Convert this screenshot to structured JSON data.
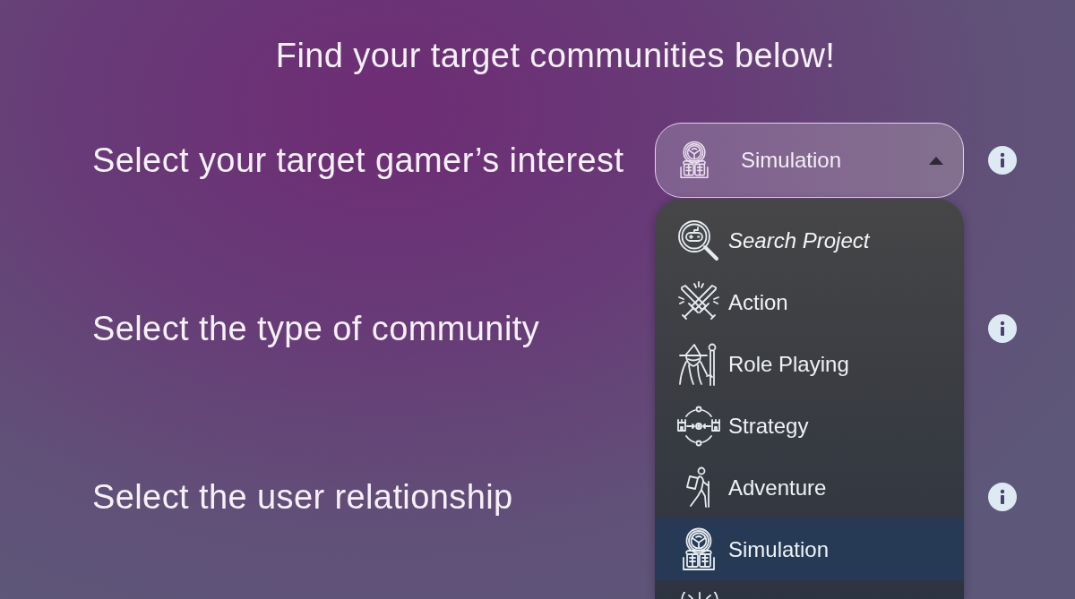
{
  "heading": "Find your target communities below!",
  "rows": [
    {
      "label": "Select your target gamer’s interest",
      "dropdown": {
        "value": "Simulation",
        "expanded": true
      }
    },
    {
      "label": "Select the type of community"
    },
    {
      "label": "Select the user relationship"
    }
  ],
  "menu": {
    "search": {
      "placeholder": "Search Project"
    },
    "options": [
      {
        "label": "Action",
        "selected": false
      },
      {
        "label": "Role Playing",
        "selected": false
      },
      {
        "label": "Strategy",
        "selected": false
      },
      {
        "label": "Adventure",
        "selected": false
      },
      {
        "label": "Simulation",
        "selected": true
      }
    ]
  }
}
